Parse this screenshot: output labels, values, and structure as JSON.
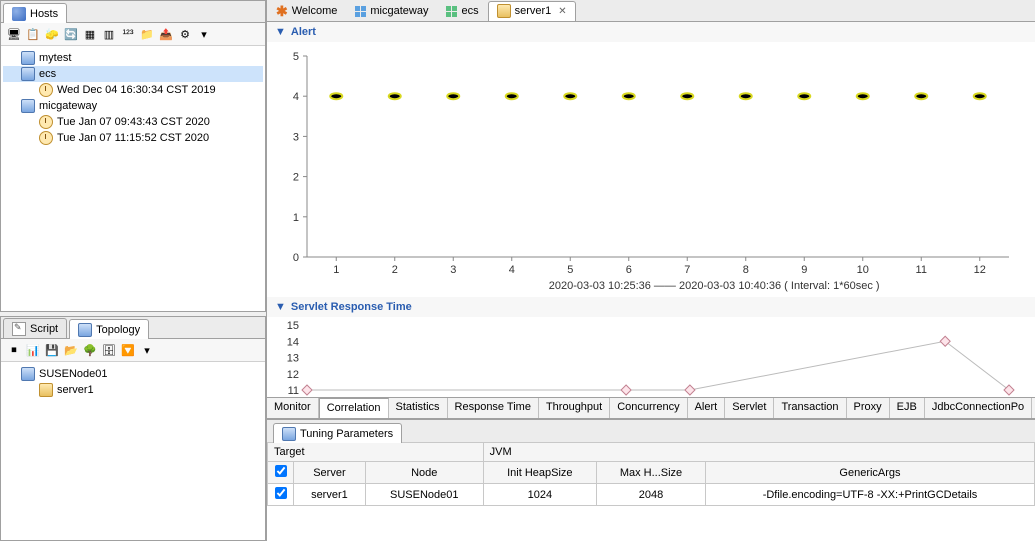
{
  "left": {
    "hosts_tab": "Hosts",
    "tree": [
      {
        "label": "mytest",
        "icon": "node",
        "indent": 0
      },
      {
        "label": "ecs",
        "icon": "node",
        "indent": 0,
        "selected": true
      },
      {
        "label": "Wed Dec 04 16:30:34 CST 2019",
        "icon": "clock",
        "indent": 1
      },
      {
        "label": "micgateway",
        "icon": "node",
        "indent": 0
      },
      {
        "label": "Tue Jan 07 09:43:43 CST 2020",
        "icon": "clock",
        "indent": 1
      },
      {
        "label": "Tue Jan 07 11:15:52 CST 2020",
        "icon": "clock",
        "indent": 1
      }
    ],
    "script_tab": "Script",
    "topology_tab": "Topology",
    "topo_tree": [
      {
        "label": "SUSENode01",
        "icon": "node",
        "indent": 0
      },
      {
        "label": "server1",
        "icon": "server",
        "indent": 1
      }
    ]
  },
  "editor_tabs": [
    {
      "label": "Welcome",
      "kind": "welcome"
    },
    {
      "label": "micgateway",
      "kind": "grid"
    },
    {
      "label": "ecs",
      "kind": "grid-green"
    },
    {
      "label": "server1",
      "kind": "server",
      "active": true
    }
  ],
  "alert_section": "Alert",
  "srt_section": "Servlet Response Time",
  "chart_data": [
    {
      "type": "scatter",
      "title": "Alert",
      "x": [
        1,
        2,
        3,
        4,
        5,
        6,
        7,
        8,
        9,
        10,
        11,
        12
      ],
      "y": [
        4,
        4,
        4,
        4,
        4,
        4,
        4,
        4,
        4,
        4,
        4,
        4
      ],
      "ylim": [
        0,
        5
      ],
      "yticks": [
        0,
        1,
        2,
        3,
        4,
        5
      ],
      "xlabel": "2020-03-03 10:25:36 —— 2020-03-03 10:40:36 ( Interval: 1*60sec )",
      "ylabel": ""
    },
    {
      "type": "line",
      "title": "Servlet Response Time",
      "x": [
        1,
        6,
        7,
        11,
        12
      ],
      "y": [
        11,
        11,
        11,
        14,
        11
      ],
      "ylim": [
        11,
        15
      ],
      "yticks": [
        11,
        12,
        13,
        14,
        15
      ],
      "xlabel": "",
      "ylabel": ""
    }
  ],
  "bottom_tabs": [
    "Monitor",
    "Correlation",
    "Statistics",
    "Response Time",
    "Throughput",
    "Concurrency",
    "Alert",
    "Servlet",
    "Transaction",
    "Proxy",
    "EJB",
    "JdbcConnectionPo"
  ],
  "bottom_tab_selected": 1,
  "tuning_tab": "Tuning Parameters",
  "tuning_groups": {
    "target": "Target",
    "jvm": "JVM"
  },
  "tuning_headers": {
    "cb": "",
    "server": "Server",
    "node": "Node",
    "init": "Init HeapSize",
    "max": "Max H...Size",
    "args": "GenericArgs"
  },
  "tuning_row": {
    "checked": true,
    "server": "server1",
    "node": "SUSENode01",
    "init": "1024",
    "max": "2048",
    "args": "-Dfile.encoding=UTF-8 -XX:+PrintGCDetails"
  }
}
